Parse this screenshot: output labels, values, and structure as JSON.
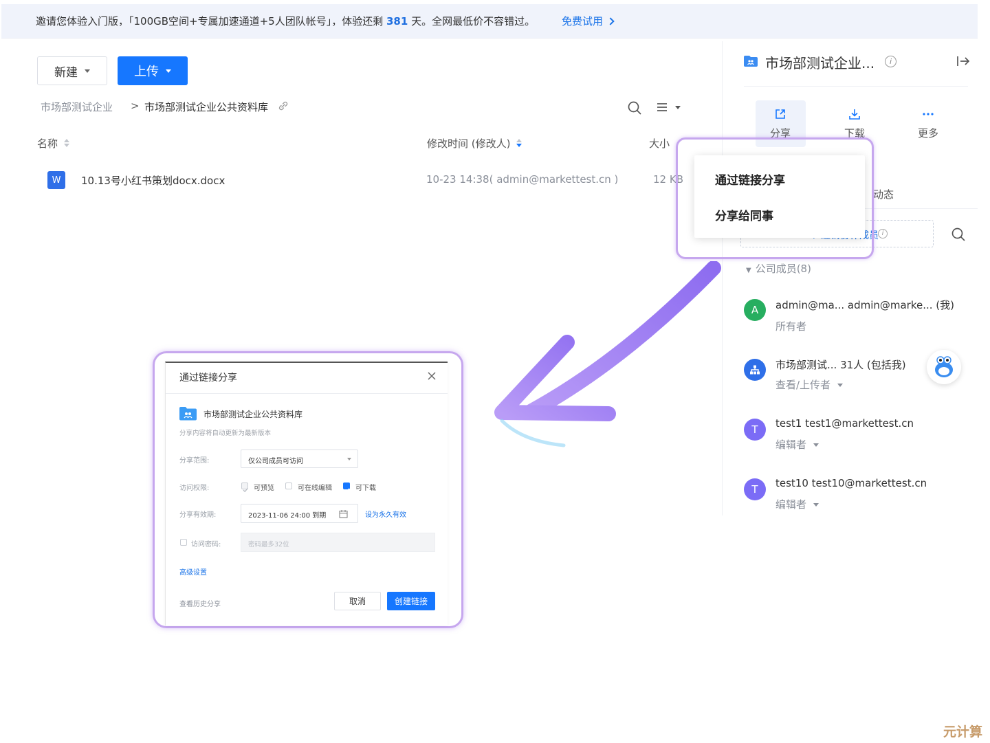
{
  "banner": {
    "text_before": "邀请您体验入门版，「100GB空间+专属加速通道+5人团队帐号」，体验还剩 ",
    "days": "381",
    "text_after": " 天。全网最低价不容错过。",
    "cta": "免费试用"
  },
  "toolbar": {
    "new_label": "新建",
    "upload_label": "上传"
  },
  "breadcrumb": {
    "root": "市场部测试企业",
    "separator": ">",
    "current": "市场部测试企业公共资料库"
  },
  "file_table": {
    "columns": {
      "name": "名称",
      "mtime": "修改时间 (修改人)",
      "size": "大小"
    },
    "rows": [
      {
        "icon": "W",
        "name": "10.13号小红书策划docx.docx",
        "mtime": "10-23 14:38( admin@markettest.cn )",
        "size": "12 KB"
      }
    ]
  },
  "right_panel": {
    "title": "市场部测试企业...",
    "actions": {
      "share": "分享",
      "download": "下载",
      "more": "更多"
    },
    "dynamic_partial": "动态",
    "add_member_partial": "+ 邀请协作成员",
    "members_header": "公司成员(8)",
    "members": [
      {
        "avatar": "A",
        "color": "#27ae60",
        "name": "admin@ma...  admin@marke...  (我)",
        "role": "所有者",
        "has_dropdown": false
      },
      {
        "avatar": "group",
        "color": "#2f6fe8",
        "name": "市场部测试...  31人  (包括我)",
        "role": "查看/上传者",
        "has_dropdown": true
      },
      {
        "avatar": "T",
        "color": "#7b6cf6",
        "name": "test1   test1@markettest.cn",
        "role": "编辑者",
        "has_dropdown": true
      },
      {
        "avatar": "T",
        "color": "#7b6cf6",
        "name": "test10   test10@markettest.cn",
        "role": "编辑者",
        "has_dropdown": true
      }
    ]
  },
  "share_menu": {
    "items": [
      "通过链接分享",
      "分享给同事"
    ]
  },
  "dialog": {
    "title": "通过链接分享",
    "folder_name": "市场部测试企业公共资料库",
    "note": "分享内容将自动更新为最新版本",
    "scope_label": "分享范围:",
    "scope_value": "仅公司成员可访问",
    "perm_label": "访问权限:",
    "perm_options": [
      {
        "label": "可预览",
        "checked": true,
        "disabled": true
      },
      {
        "label": "可在线编辑",
        "checked": false,
        "disabled": false
      },
      {
        "label": "可下载",
        "checked": true,
        "disabled": false
      }
    ],
    "expiry_label": "分享有效期:",
    "expiry_value": "2023-11-06 24:00 到期",
    "forever_link": "设为永久有效",
    "password_label": "访问密码:",
    "password_placeholder": "密码最多32位",
    "advanced": "高级设置",
    "history": "查看历史分享",
    "cancel": "取消",
    "create": "创建链接"
  },
  "watermark": "元计算",
  "colors": {
    "primary": "#1677ff",
    "highlight": "#c6a7ee",
    "arrow": "#a77bf0"
  }
}
